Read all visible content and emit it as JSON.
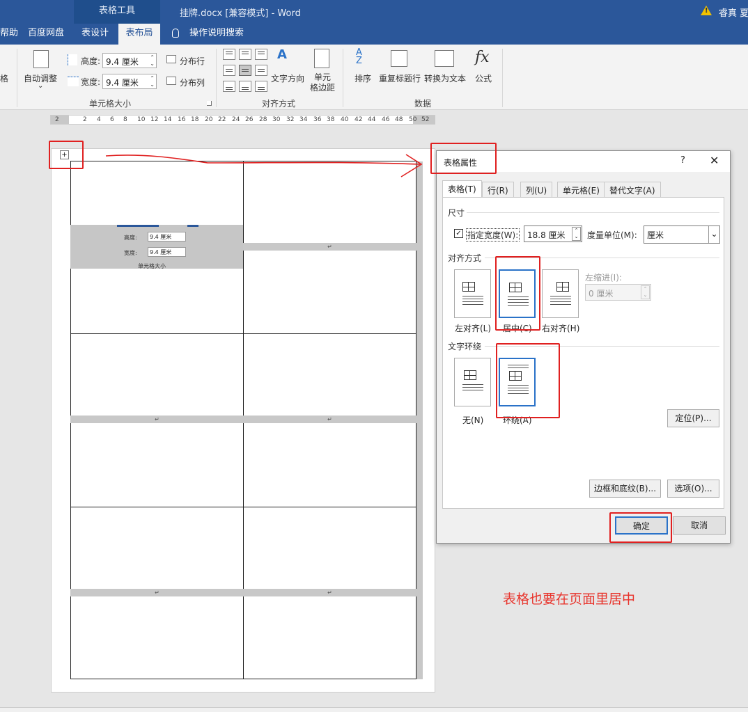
{
  "titlebar": {
    "tool_tab": "表格工具",
    "document_title": "挂牌.docx [兼容模式]  -  Word",
    "warning_glyph": "!",
    "user": "睿真 夏"
  },
  "tabs": {
    "help": "帮助",
    "baidu": "百度网盘",
    "design": "表设计",
    "layout": "表布局",
    "tell_me": "操作说明搜索"
  },
  "ribbon": {
    "cut_left": "格",
    "autofit": "自动调整",
    "autofit_arrow": "⌄",
    "height_label": "高度:",
    "height_value": "9.4 厘米",
    "width_label": "宽度:",
    "width_value": "9.4 厘米",
    "distribute_rows": "分布行",
    "distribute_cols": "分布列",
    "cell_size_group": "单元格大小",
    "text_direction": "文字方向",
    "cell_margins": "单元\n格边距",
    "align_group": "对齐方式",
    "sort": "排序",
    "repeat_header": "重复标题行",
    "convert_text": "转换为文本",
    "formula": "公式",
    "data_group": "数据",
    "spin_arrows": "⌃\n⌄"
  },
  "ruler": {
    "ticks": [
      "2",
      "2",
      "4",
      "6",
      "8",
      "10",
      "12",
      "14",
      "16",
      "18",
      "20",
      "22",
      "24",
      "26",
      "28",
      "30",
      "32",
      "34",
      "36",
      "38",
      "40",
      "42",
      "44",
      "46",
      "48",
      "50",
      "52"
    ]
  },
  "document": {
    "paragraph_mark": "↵",
    "embed_height_label": "高度:",
    "embed_height_value": "9.4 厘米",
    "embed_width_label": "宽度:",
    "embed_width_value": "9.4 厘米",
    "embed_group": "单元格大小"
  },
  "dialog": {
    "title": "表格属性",
    "help": "?",
    "close": "✕",
    "tabs": [
      "表格(T)",
      "行(R)",
      "列(U)",
      "单元格(E)",
      "替代文字(A)"
    ],
    "size_section": "尺寸",
    "preferred_width_label": "指定宽度(W):",
    "preferred_width_checked": true,
    "preferred_width_value": "18.8 厘米",
    "measure_in_label": "度量单位(M):",
    "measure_in_value": "厘米",
    "alignment_section": "对齐方式",
    "align_left": "左对齐(L)",
    "align_center": "居中(C)",
    "align_right": "右对齐(H)",
    "indent_label": "左缩进(I):",
    "indent_value": "0 厘米",
    "wrapping_section": "文字环绕",
    "wrap_none": "无(N)",
    "wrap_around": "环绕(A)",
    "positioning": "定位(P)...",
    "borders_shading": "边框和底纹(B)...",
    "options": "选项(O)...",
    "ok": "确定",
    "cancel": "取消",
    "check_glyph": "✓",
    "dropdown_glyph": "⌄"
  },
  "annotation": {
    "text": "表格也要在页面里居中",
    "color": "#e8342c"
  },
  "colors": {
    "ribbon_blue": "#2b579a",
    "selection_blue": "#2a72c8",
    "highlight_red": "#e02020"
  }
}
